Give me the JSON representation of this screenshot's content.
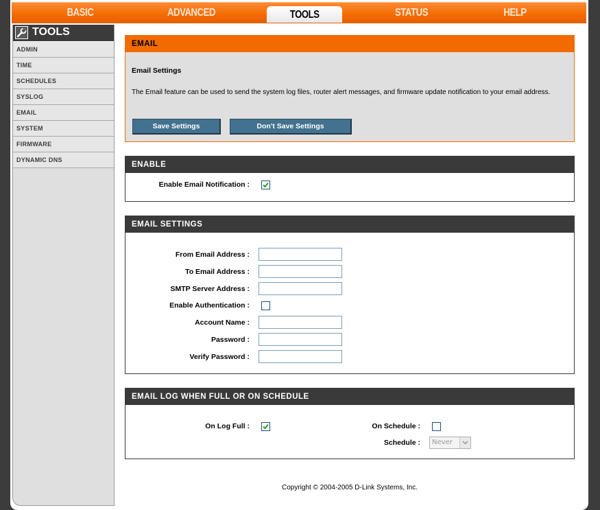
{
  "nav": {
    "tabs": [
      {
        "label": "BASIC"
      },
      {
        "label": "ADVANCED"
      },
      {
        "label": "TOOLS",
        "active": true
      },
      {
        "label": "STATUS"
      },
      {
        "label": "HELP"
      }
    ]
  },
  "sidebar": {
    "title": "TOOLS",
    "icon": "wrench-icon",
    "items": [
      {
        "label": "ADMIN"
      },
      {
        "label": "TIME"
      },
      {
        "label": "SCHEDULES"
      },
      {
        "label": "SYSLOG"
      },
      {
        "label": "EMAIL"
      },
      {
        "label": "SYSTEM"
      },
      {
        "label": "FIRMWARE"
      },
      {
        "label": "DYNAMIC DNS"
      }
    ]
  },
  "email": {
    "heading": "EMAIL",
    "subtitle": "Email Settings",
    "description": "The Email feature can be used to send the system log files, router alert messages, and firmware update notification to your email address.",
    "save_label": "Save Settings",
    "dont_save_label": "Don't Save Settings"
  },
  "enable": {
    "heading": "ENABLE",
    "notification_label": "Enable Email Notification :",
    "notification_checked": true
  },
  "settings": {
    "heading": "EMAIL SETTINGS",
    "from_label": "From Email Address :",
    "from_value": "",
    "to_label": "To Email Address :",
    "to_value": "",
    "smtp_label": "SMTP Server Address :",
    "smtp_value": "",
    "auth_label": "Enable Authentication :",
    "auth_checked": false,
    "account_label": "Account Name :",
    "account_value": "",
    "password_label": "Password :",
    "password_value": "",
    "verify_label": "Verify Password :",
    "verify_value": ""
  },
  "log": {
    "heading": "EMAIL LOG WHEN FULL OR ON SCHEDULE",
    "full_label": "On Log Full :",
    "full_checked": true,
    "schedule_label": "On Schedule :",
    "schedule_checked": false,
    "schedule_select_label": "Schedule :",
    "schedule_value": "Never"
  },
  "footer": {
    "copyright": "Copyright © 2004-2005 D-Link Systems, Inc."
  },
  "colors": {
    "accent": "#f26b00",
    "header_dark": "#3a3a3a",
    "button": "#42728f"
  }
}
